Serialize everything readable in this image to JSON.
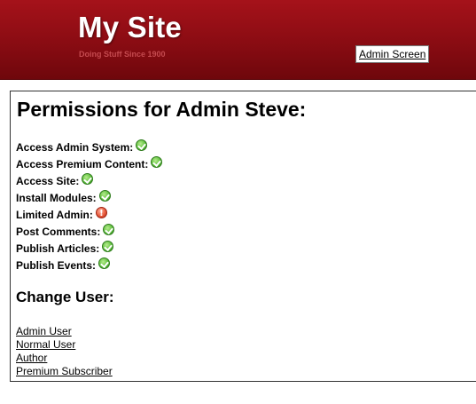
{
  "header": {
    "site_title": "My Site",
    "tagline": "Doing Stuff Since 1900",
    "admin_link": "Admin Screen",
    "colors": {
      "banner": "#8f0d14",
      "tagline": "#c44a4f"
    }
  },
  "main": {
    "title": "Permissions for Admin Steve:",
    "permissions": [
      {
        "label": "Access Admin System:",
        "status": "ok",
        "icon": "check-icon"
      },
      {
        "label": "Access Premium Content:",
        "status": "ok",
        "icon": "check-icon"
      },
      {
        "label": "Access Site:",
        "status": "ok",
        "icon": "check-icon"
      },
      {
        "label": "Install Modules:",
        "status": "ok",
        "icon": "check-icon"
      },
      {
        "label": "Limited Admin:",
        "status": "warn",
        "icon": "exclamation-icon"
      },
      {
        "label": "Post Comments:",
        "status": "ok",
        "icon": "check-icon"
      },
      {
        "label": "Publish Articles:",
        "status": "ok",
        "icon": "check-icon"
      },
      {
        "label": "Publish Events:",
        "status": "ok",
        "icon": "check-icon"
      }
    ],
    "change_user_title": "Change User:",
    "user_links": [
      "Admin User",
      "Normal User",
      "Author",
      "Premium Subscriber"
    ]
  }
}
